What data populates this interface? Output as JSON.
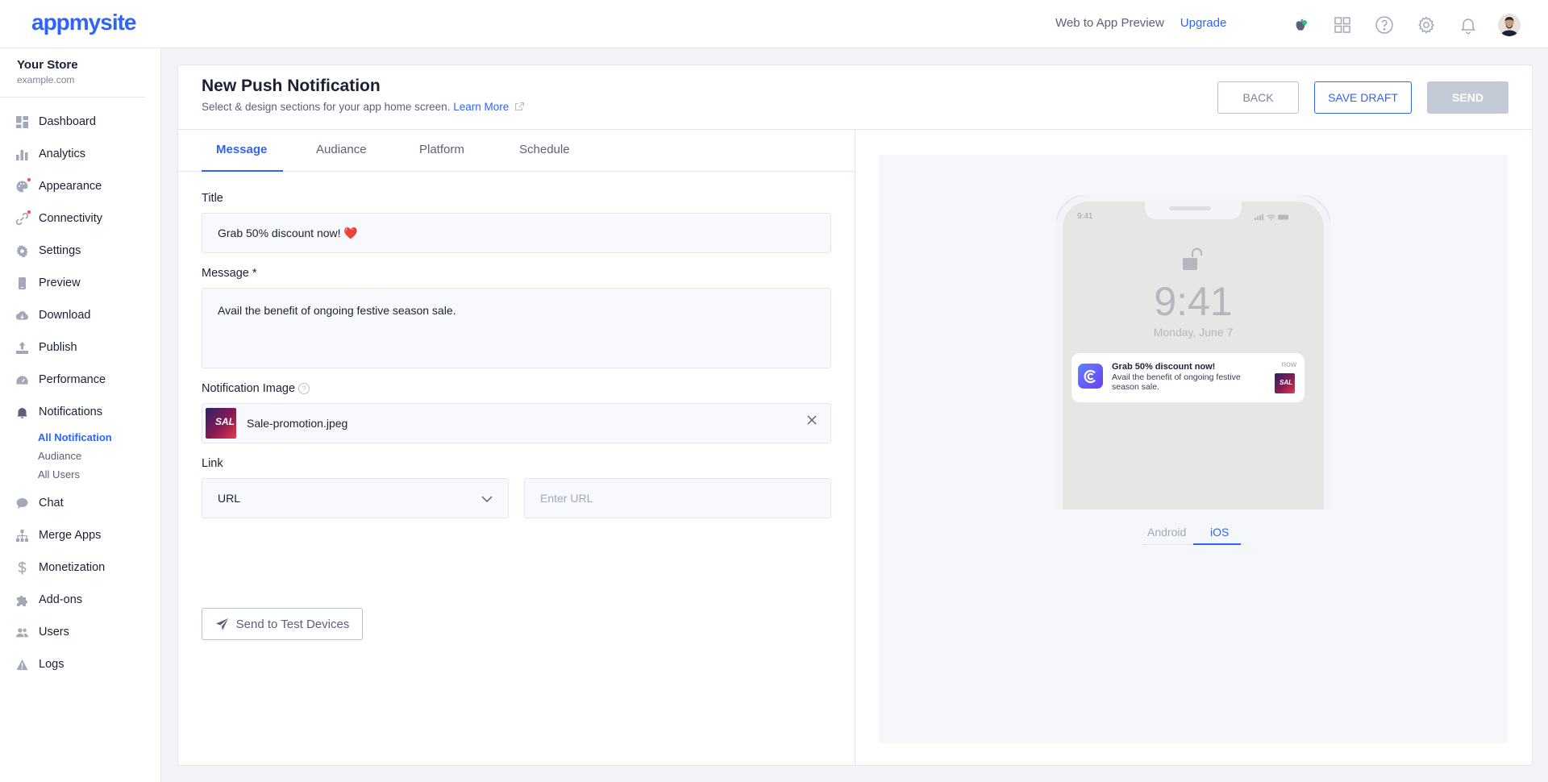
{
  "brand": {
    "logo_text": "appmysite",
    "accent": "#3064f6"
  },
  "header": {
    "links": [
      "Web to App Preview",
      "Upgrade"
    ],
    "icons": [
      "apple-icon",
      "grid-icon",
      "help-icon",
      "gear-icon",
      "bell-icon",
      "user-avatar"
    ]
  },
  "sidebar": {
    "store_name": "Your Store",
    "store_url": "example.com",
    "items": [
      {
        "label": "Dashboard",
        "icon": "dashboard-icon"
      },
      {
        "label": "Analytics",
        "icon": "analytics-icon"
      },
      {
        "label": "Appearance",
        "icon": "appearance-icon"
      },
      {
        "label": "Connectivity",
        "icon": "connectivity-icon"
      },
      {
        "label": "Settings",
        "icon": "settings-icon"
      },
      {
        "label": "Preview",
        "icon": "preview-icon"
      },
      {
        "label": "Download",
        "icon": "download-icon"
      },
      {
        "label": "Publish",
        "icon": "publish-icon"
      },
      {
        "label": "Performance",
        "icon": "performance-icon"
      },
      {
        "label": "Notifications",
        "icon": "notifications-icon"
      },
      {
        "label": "Chat",
        "icon": "chat-icon"
      },
      {
        "label": "Merge Apps",
        "icon": "merge-icon"
      },
      {
        "label": "Monetization",
        "icon": "monetization-icon"
      },
      {
        "label": "Add-ons",
        "icon": "addons-icon"
      },
      {
        "label": "Users",
        "icon": "users-icon"
      },
      {
        "label": "Logs",
        "icon": "logs-icon"
      }
    ],
    "subitems": [
      "All Notification",
      "Audiance",
      "All Users"
    ]
  },
  "page": {
    "title": "New Push Notification",
    "subtitle": "Select & design sections for your app home screen.",
    "learn_more": "Learn More",
    "buttons": {
      "back": "BACK",
      "save_draft": "SAVE DRAFT",
      "send": "SEND"
    }
  },
  "tabs": [
    "Message",
    "Audiance",
    "Platform",
    "Schedule"
  ],
  "form": {
    "title_label": "Title",
    "title_value": "Grab 50% discount now! ❤️",
    "message_label": "Message *",
    "message_value": "Avail the benefit of ongoing festive season sale.",
    "image_label": "Notification Image",
    "image_file": "Sale-promotion.jpeg",
    "image_thumb_text": "SAL",
    "link_label": "Link",
    "link_type": "URL",
    "url_placeholder": "Enter URL",
    "test_button": "Send to Test Devices"
  },
  "preview": {
    "status_time": "9:41",
    "lock_time": "9:41",
    "lock_date": "Monday, June 7",
    "notif_title": "Grab 50% discount now!",
    "notif_message": "Avail the benefit of ongoing festive season sale.",
    "notif_time": "now",
    "notif_thumb_text": "SAL",
    "os_tabs": [
      "Android",
      "iOS"
    ]
  }
}
